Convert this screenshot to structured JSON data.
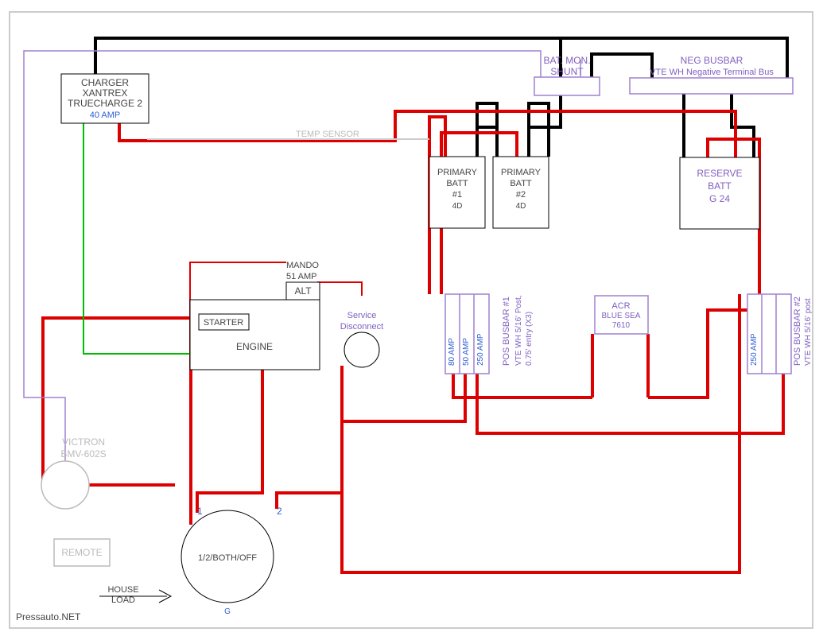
{
  "charger": {
    "l1": "CHARGER",
    "l2": "XANTREX",
    "l3": "TRUECHARGE 2",
    "amp": "40 AMP"
  },
  "temp_sensor": "TEMP SENSOR",
  "bat_mon_shunt": {
    "l1": "BAT. MON.",
    "l2": "SHUNT"
  },
  "neg_busbar": {
    "l1": "NEG BUSBAR",
    "l2": "VTE WH Negative Terminal Bus"
  },
  "primary_batt_1": {
    "l1": "PRIMARY",
    "l2": "BATT",
    "l3": "#1",
    "l4": "4D"
  },
  "primary_batt_2": {
    "l1": "PRIMARY",
    "l2": "BATT",
    "l3": "#2",
    "l4": "4D"
  },
  "reserve_batt": {
    "l1": "RESERVE",
    "l2": "BATT",
    "l3": "G 24"
  },
  "mando": {
    "l1": "MANDO",
    "l2": "51 AMP",
    "alt": "ALT"
  },
  "engine": {
    "starter": "STARTER",
    "label": "ENGINE"
  },
  "service_disc": {
    "l1": "Service",
    "l2": "Disconnect"
  },
  "pos_busbar_1": {
    "l1": "POS BUSBAR #1",
    "l2": "VTE WH 5/16' Post,",
    "l3": "0.75' entry (X3)",
    "a1": "80 AMP",
    "a2": "50 AMP",
    "a3": "250 AMP"
  },
  "pos_busbar_2": {
    "l1": "POS BUSBAR #2",
    "l2": "VTE WH 5/16' post",
    "a1": "250 AMP"
  },
  "acr": {
    "l1": "ACR",
    "l2": "BLUE SEA",
    "l3": "7610"
  },
  "victron": {
    "l1": "VICTRON",
    "l2": "BMV-602S"
  },
  "remote": "REMOTE",
  "house_load": {
    "l1": "HOUSE",
    "l2": "LOAD"
  },
  "switch": {
    "label": "1/2/BOTH/OFF",
    "n1": "1",
    "n2": "2"
  },
  "watermark": "Pressauto.NET",
  "ground": "G"
}
